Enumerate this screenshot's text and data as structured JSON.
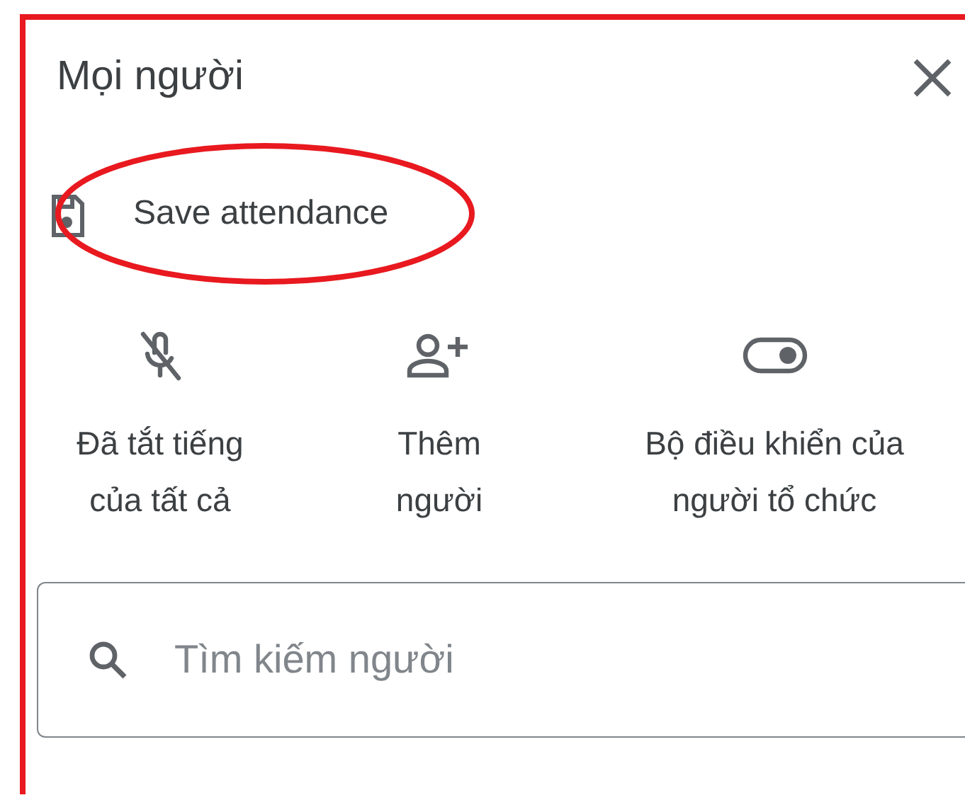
{
  "panel": {
    "title": "Mọi người"
  },
  "save_attendance": {
    "label": "Save attendance",
    "highlighted": true
  },
  "actions": [
    {
      "kind": "mute",
      "label": "Đã tắt tiếng của tất cả"
    },
    {
      "kind": "add-person",
      "label": "Thêm người"
    },
    {
      "kind": "toggle",
      "label": "Bộ điều khiển của người tổ chức"
    }
  ],
  "search": {
    "placeholder": "Tìm kiếm người"
  }
}
